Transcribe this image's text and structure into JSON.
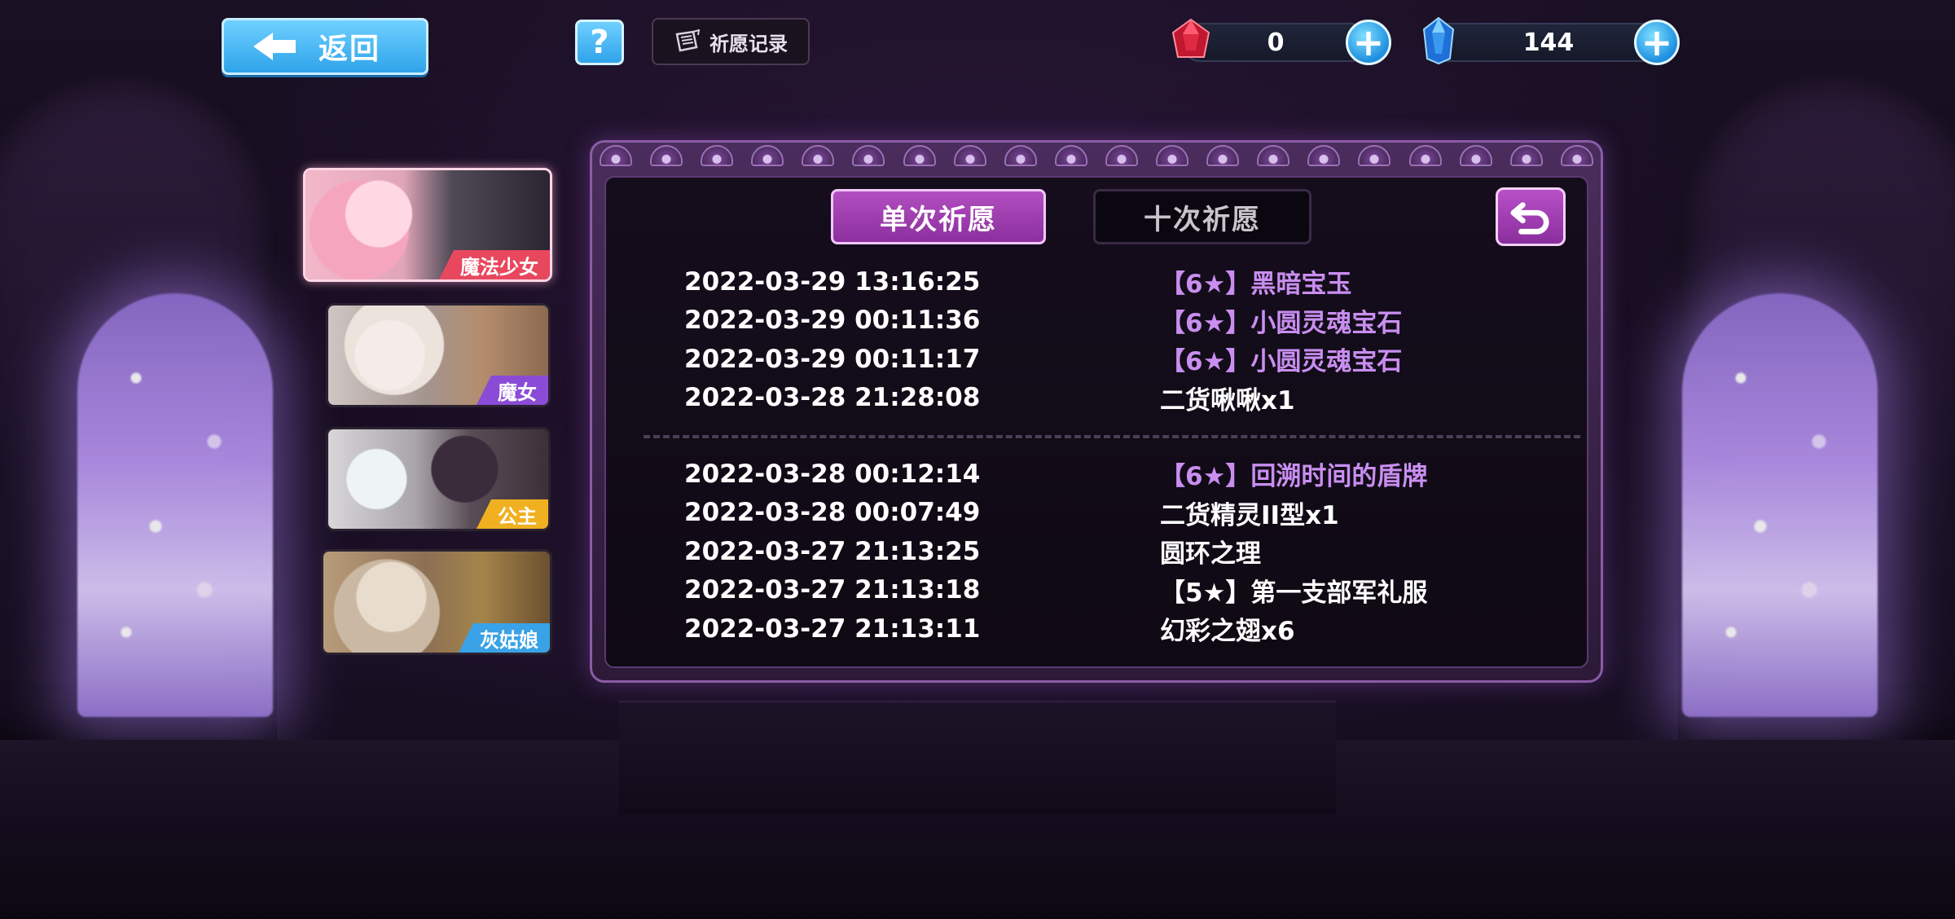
{
  "top_bar": {
    "back_label": "返回",
    "help_label": "?",
    "record_label": "祈愿记录",
    "record_icon": "scroll-icon",
    "currencies": [
      {
        "name": "red-gem",
        "icon": "red-gem-icon",
        "value": "0",
        "color": "#e8485e"
      },
      {
        "name": "blue-gem",
        "icon": "blue-crystal-icon",
        "value": "144",
        "color": "#3aa2e6"
      }
    ]
  },
  "banners": [
    {
      "label": "魔法少女",
      "active": true,
      "tag_color": "#e8485e"
    },
    {
      "label": "魔女",
      "active": false,
      "tag_color": "#8a4cd6"
    },
    {
      "label": "公主",
      "active": false,
      "tag_color": "#f0b020"
    },
    {
      "label": "灰姑娘",
      "active": false,
      "tag_color": "#3aa2e6"
    }
  ],
  "panel": {
    "tabs": [
      {
        "label": "单次祈愿",
        "active": true
      },
      {
        "label": "十次祈愿",
        "active": false
      }
    ],
    "undo_icon": "undo-arrow-icon",
    "record_groups": [
      [
        {
          "time": "2022-03-29 13:16:25",
          "item": "【6★】黑暗宝玉",
          "rare": true
        },
        {
          "time": "2022-03-29 00:11:36",
          "item": "【6★】小圆灵魂宝石",
          "rare": true
        },
        {
          "time": "2022-03-29 00:11:17",
          "item": "【6★】小圆灵魂宝石",
          "rare": true
        },
        {
          "time": "2022-03-28 21:28:08",
          "item": "二货啾啾x1",
          "rare": false
        }
      ],
      [
        {
          "time": "2022-03-28 00:12:14",
          "item": "【6★】回溯时间的盾牌",
          "rare": true
        },
        {
          "time": "2022-03-28 00:07:49",
          "item": "二货精灵II型x1",
          "rare": false
        },
        {
          "time": "2022-03-27 21:13:25",
          "item": "圆环之理",
          "rare": false
        },
        {
          "time": "2022-03-27 21:13:18",
          "item": "【5★】第一支部军礼服",
          "rare": false
        },
        {
          "time": "2022-03-27 21:13:11",
          "item": "幻彩之翅x6",
          "rare": false
        }
      ]
    ]
  },
  "colors": {
    "rare_text": "#c98ef0",
    "accent_blue": "#2fa3ea",
    "accent_purple": "#b24fc0"
  }
}
